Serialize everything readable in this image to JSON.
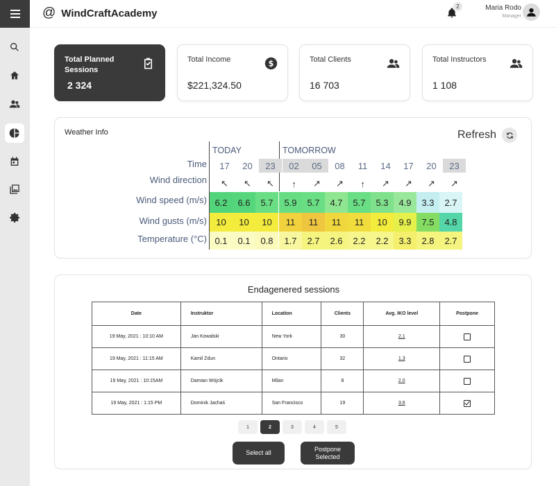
{
  "header": {
    "brand_symbol": "@",
    "brand": "WindCraftAcademy",
    "notifications_count": "2",
    "user_name": "Maria Rodo",
    "user_role": "Manager"
  },
  "sidebar": {
    "items": [
      "menu-icon",
      "search-icon",
      "home-icon",
      "users-icon",
      "pie-chart-icon",
      "calendar-icon",
      "image-icon",
      "gear-icon"
    ],
    "active": "pie-chart-icon"
  },
  "stats": [
    {
      "label": "Total Planned Sessions",
      "value": "2 324",
      "icon": "clipboard-check-icon"
    },
    {
      "label": "Total Income",
      "value": "$221,324.50",
      "icon": "dollar-icon"
    },
    {
      "label": "Total Clients",
      "value": "16 703",
      "icon": "users-icon"
    },
    {
      "label": "Total Instructors",
      "value": "1 108",
      "icon": "users-icon"
    }
  ],
  "weather": {
    "title": "Weather Info",
    "refresh_label": "Refresh",
    "today_label": "TODAY",
    "tomorrow_label": "TOMORROW",
    "row_labels": {
      "time": "Time",
      "direction": "Wind direction",
      "speed": "Wind speed (m/s)",
      "gusts": "Wind gusts (m/s)",
      "temp": "Temperature (°C)"
    },
    "times": [
      "17",
      "20",
      "23",
      "02",
      "05",
      "08",
      "11",
      "14",
      "17",
      "20",
      "23"
    ],
    "shaded_times": [
      2,
      3,
      4,
      10
    ],
    "directions": [
      "↖",
      "↖",
      "↖",
      "↑",
      "↗",
      "↗",
      "↑",
      "↗",
      "↗",
      "↗",
      "↗"
    ],
    "speed": [
      "6.2",
      "6.6",
      "5.7",
      "5.9",
      "5.7",
      "4.7",
      "5.7",
      "5.3",
      "4.9",
      "3.3",
      "2.7"
    ],
    "speed_colors": [
      "#52d57a",
      "#55d67c",
      "#6ade84",
      "#66dd82",
      "#6ade84",
      "#8fe690",
      "#6ade84",
      "#80e18c",
      "#99e79a",
      "#c4eef0",
      "#d9f5f5"
    ],
    "gusts": [
      "10",
      "10",
      "10",
      "11",
      "11",
      "11",
      "11",
      "10",
      "9.9",
      "7.5",
      "4.8"
    ],
    "gusts_colors": [
      "#f3ec3c",
      "#f3ec3c",
      "#f3ec3c",
      "#f1d23e",
      "#efc63f",
      "#f1d73e",
      "#f1dc3e",
      "#f3ec3c",
      "#e5f04a",
      "#84dc62",
      "#54d6a8"
    ],
    "temp": [
      "0.1",
      "0.1",
      "0.8",
      "1.7",
      "2.7",
      "2.6",
      "2.2",
      "2.2",
      "3.3",
      "2.8",
      "2.7"
    ],
    "temp_colors": [
      "#fbfbc4",
      "#fbfbc4",
      "#fbfaba",
      "#f8f79f",
      "#f5f47e",
      "#f5f481",
      "#f7f68d",
      "#f7f68d",
      "#f4f06d",
      "#f5f47e",
      "#f5f47e"
    ]
  },
  "sessions": {
    "title": "Endagenered sessions",
    "columns": [
      "Date",
      "Instruktor",
      "Location",
      "Clients",
      "Avg. IKO level",
      "Postpone"
    ],
    "rows": [
      {
        "date": "19 May, 2021 : 10:10 AM",
        "instructor": "Jan Kowalski",
        "location": "New York",
        "clients": "30",
        "iko": "2.1",
        "postpone": false
      },
      {
        "date": "19 May, 2021 : 11:15 AM",
        "instructor": "Kamil Zdun",
        "location": "Ontario",
        "clients": "32",
        "iko": "1.3",
        "postpone": false
      },
      {
        "date": "19 May, 2021 : 10:15AM",
        "instructor": "Damian Wójcik",
        "location": "Milan",
        "clients": "8",
        "iko": "2.0",
        "postpone": false
      },
      {
        "date": "19 May, 2021 : 1:15 PM",
        "instructor": "Dominik Jachaś",
        "location": "San Francisco",
        "clients": "19",
        "iko": "3.6",
        "postpone": true
      }
    ],
    "pages": [
      "1",
      "2",
      "3",
      "4",
      "5"
    ],
    "current_page": "2",
    "select_all_label": "Select all",
    "postpone_selected_label": "Postpone Selected"
  }
}
